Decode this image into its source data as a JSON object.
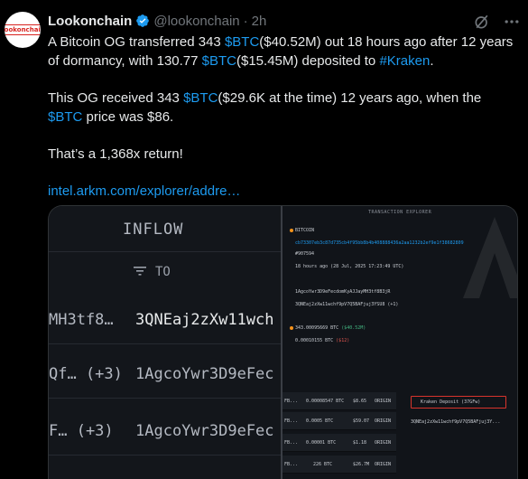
{
  "tweet": {
    "avatar_text": "Lookonchain",
    "author_name": "Lookonchain",
    "handle": "@lookonchain",
    "dot": "·",
    "time": "2h",
    "line1_a": "A Bitcoin OG transferred 343 ",
    "line1_tag": "$BTC",
    "line1_b": "($40.52M) out 18 hours ago after 12 years of dormancy, with 130.77 ",
    "line1_tag2": "$BTC",
    "line1_c": "($15.45M) deposited to ",
    "line1_tag3": "#Kraken",
    "line1_d": ".",
    "line2_a": "This OG received 343 ",
    "line2_tag": "$BTC",
    "line2_b": "($29.6K at the time) 12 years ago, when the ",
    "line2_tag2": "$BTC",
    "line2_c": " price was $86.",
    "line3": "That’s a 1,368x return!",
    "link": "intel.arkm.com/explorer/addre…",
    "colors": {
      "accent": "#1d9bf0",
      "text": "#e7e9ea",
      "muted": "#71767b",
      "background": "#000000"
    }
  },
  "media_left": {
    "inflow_label": "INFLOW",
    "to_label": "TO",
    "rows": [
      {
        "from": "MH3tf8…",
        "to": "3QNEaj2zXw11wch"
      },
      {
        "from": "Qf… (+3)",
        "to": "1AgcoYwr3D9eFec"
      },
      {
        "from": "F… (+3)",
        "to": "1AgcoYwr3D9eFec"
      }
    ]
  },
  "media_right": {
    "title": "TRANSACTION EXPLORER",
    "coin": "BITCOIN",
    "tx_hash": "cb73307eb3c87d735cb4f95bb8b4b408888436a2aa1232b2ef9e1f38682809",
    "block": "#907594",
    "time_line": "18 hours ago  (28 Jul, 2025 17:23:49 UTC)",
    "from_addr": "1AgcoYwr3D9eFecdomKyAJJayMH3tf8B3jR",
    "to_addr": "3QNEaj2zXw11wchf9pV7Q5BAFjuj3YSU8 (+1)",
    "amount": "343.00095669 BTC",
    "amount_usd": "($40.52M)",
    "fee": "0.00010155 BTC",
    "fee_usd": "($12)",
    "table": [
      {
        "addr": "FB...",
        "btc": "0.00008547 BTC",
        "usd": "$8.65",
        "tag": "ORIGIN"
      },
      {
        "addr": "FB...",
        "btc": "0.0005 BTC",
        "usd": "$59.07",
        "tag": "ORIGIN"
      },
      {
        "addr": "FB...",
        "btc": "0.00001 BTC",
        "usd": "$1.18",
        "tag": "ORIGIN"
      },
      {
        "addr": "FB...",
        "btc": "226 BTC",
        "usd": "$26.7M",
        "tag": "ORIGIN"
      }
    ],
    "kraken_label": "Kraken Deposit (37GFw)",
    "dest_line": "3QNEaj2zXw11wchf9pV7Q5BAFjuj3Y..."
  }
}
